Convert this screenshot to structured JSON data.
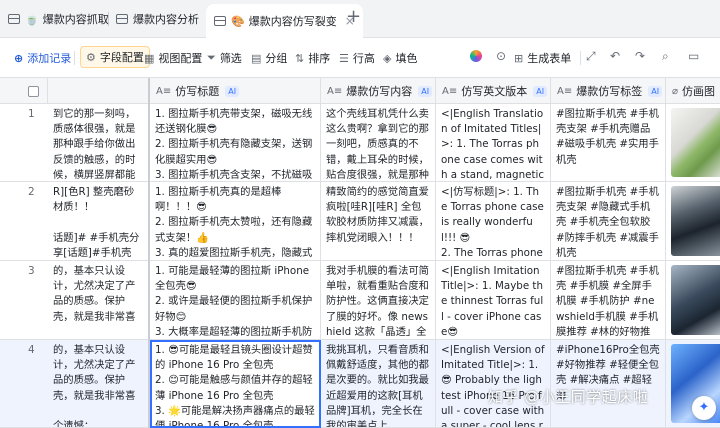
{
  "tabs": [
    {
      "emoji": "🍵",
      "label": "爆款内容抓取"
    },
    {
      "emoji": "",
      "label": "爆款内容分析"
    },
    {
      "emoji": "🎨",
      "label": "爆款内容仿写裂变"
    }
  ],
  "toolbar": {
    "add_record": "添加记录",
    "field_config": "字段配置",
    "view_config": "视图配置",
    "filter": "筛选",
    "group": "分组",
    "sort": "排序",
    "row_height": "行高",
    "fill": "填色",
    "generate_form": "生成表单"
  },
  "columns": [
    {
      "label": "",
      "ai": false
    },
    {
      "label": "仿写标题",
      "ai": true
    },
    {
      "label": "爆款仿写内容",
      "ai": true
    },
    {
      "label": "仿写英文版本",
      "ai": true
    },
    {
      "label": "爆款仿写标签",
      "ai": true
    },
    {
      "label": "仿画图",
      "ai": false
    }
  ],
  "ai_badge": "AI",
  "rows": [
    {
      "num": "1",
      "orig": "到它的那一刻吗，质感体很强，就是那种跟手给你做出反馈的触感，的时候，横屏竖屏都能它了。四角升高，镜头升美观功能通通都有了~",
      "title": "1. 图拉斯手机壳带支架，磁吸无线还送钢化膜😎\n2. 图拉斯手机壳有隐藏支架，送钢化膜超实用😎\n3. 图拉斯手机壳含支架，不扰磁吸还赠钢化膜😊",
      "content": "这个壳线耳机凭什么卖这么贵啊？拿到它的那一刻吧，质感真的不错，戴上耳朵的时候，贴合度很强，就是那种跟耳朵完美适配的感觉，硅胶的材质...",
      "english": "<|English Translation of Imitated Titles|>: 1. The Torras phone case comes with a stand, magnetic suction is unobstructed and it als...",
      "tags": "#图拉斯手机壳 #手机壳支架 #手机壳赠品 #磁吸手机壳 #实用手机壳"
    },
    {
      "num": "2",
      "orig": "R][色R] 整壳磨砂材质！！\n\n话题]# #手机壳分享[话题]#手机壳[话题]# #苹果手机壳# #平价手机壳[话题]#",
      "title": "1. 图拉斯手机壳真的是超棒啊！！！😎\n2. 图拉斯手机壳太赞啦，还有隐藏式支架！👍\n3. 真的超爱图拉斯手机壳，隐藏式支架超方便。😎",
      "content": "精致简约的感觉简直爱疯啦[哇R][哇R] 全包软胶材质防摔又减震，摔机党闭眼入！！！\n\n#时尚手机壳推荐[话题]...",
      "english": "<|仿写标题|>: 1. The Torras phone case is really wonderful!!! 😎\n2. The Torras phone case is so amazing, and it has a hidden stand! 👍...",
      "tags": "#图拉斯手机壳 #手机壳支架 #隐藏式手机壳 #手机壳全包软胶 #防摔手机壳 #减震手机壳"
    },
    {
      "num": "3",
      "orig": "的，基本只认设计，尤然决定了产品的质感。保护壳，就是我非常喜\n\n个遗憾：...",
      "title": "1. 可能是最轻薄的图拉斯 iPhone 全包壳😎\n2. 或许是最轻便的图拉斯手机保护好物😊\n3. 大概率是超轻薄的图拉斯手机防护新选择😎",
      "content": "我对手机膜的看法可简单啦，就看重贴合度和防护性。这俩直接决定了膜的好坏。像 newshield 这款「晶透」全屏手机膜，我超爱的...",
      "english": "<|English Imitation Title|>: 1. Maybe the thinnest Torras full - cover iPhone case😎\n2. Perhaps the most portable Torras mobile...",
      "tags": "#图拉斯手机壳 #手机壳 #手机膜 #全屏手机膜 #手机防护 #newshield手机膜 #手机膜推荐 #林的好物推荐"
    },
    {
      "num": "4",
      "orig": "的，基本只认设计，尤然决定了产品的质感。保护壳，就是我非常喜\n\n个遗憾：...",
      "title": "1. 😎可能是最轻且镜头圈设计超赞的 iPhone 16 Pro 全包壳\n2. 😊可能是触感与颜值并存的超轻薄 iPhone 16 Pro 全包壳\n3. 🌟可能是解决扬声器痛点的最轻便 iPhone 16 Pro 全包壳",
      "content": "我挑耳机，只看音质和佩戴舒适度，其他的都是次要的。就比如我最近超爱用的这款[耳机品牌]耳机，完全长在我的审美点上...",
      "english": "<|English Version of Imitated Title|>: 1. 😎 Probably the lightest iPhone 16 Pro full - cover case with a super - cool lens ring design...",
      "tags": "#iPhone16Pro全包壳 #好物推荐 #轻便全包壳 #解决痛点 #超轻薄"
    }
  ],
  "watermark": "知乎 @小王同学起床啦"
}
